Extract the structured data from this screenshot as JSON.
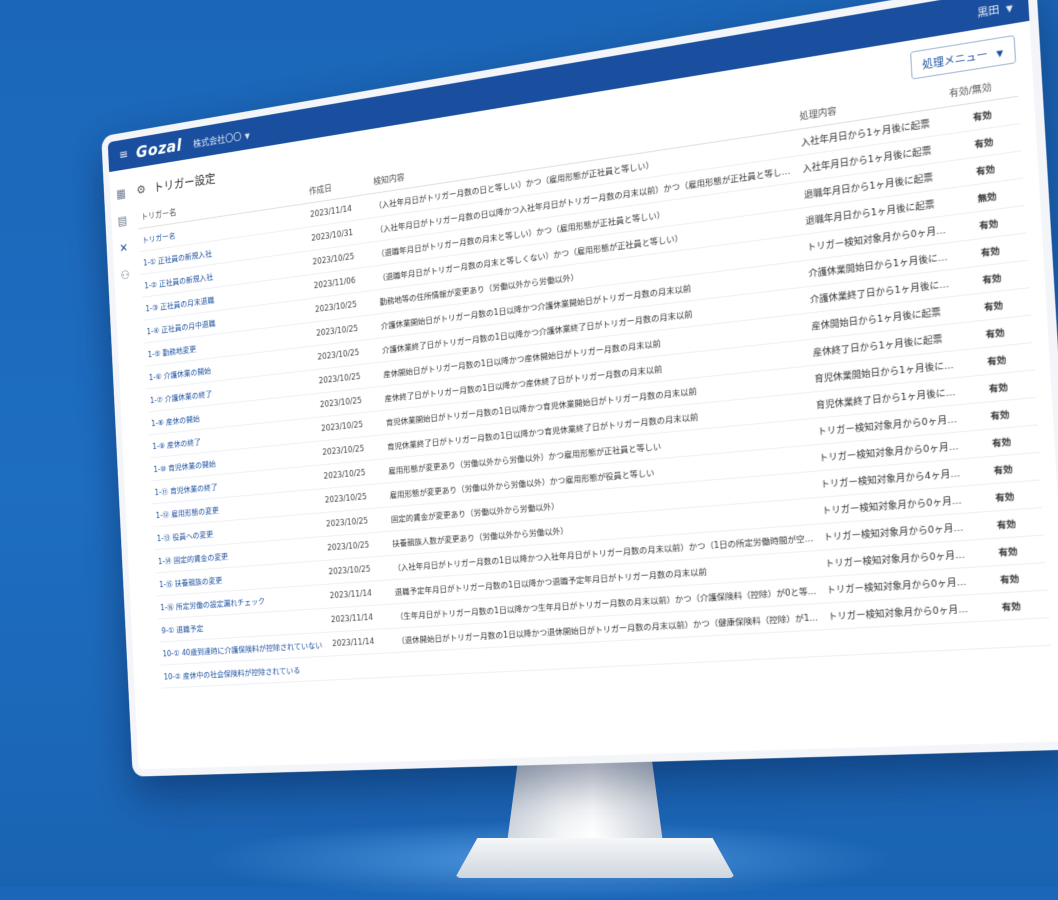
{
  "app": {
    "logo": "Gozal",
    "company": "株式会社〇〇",
    "user": "黒田"
  },
  "page": {
    "title": "トリガー設定",
    "op_menu": "処理メニュー"
  },
  "columns": {
    "name": "トリガー名",
    "date": "作成日",
    "condition": "検知内容",
    "process": "処理内容",
    "status": "有効/無効"
  },
  "rows": [
    {
      "name": "トリガー名",
      "date": "2023/11/14",
      "condition": "（入社年月日がトリガー月数の日と等しい）かつ（雇用形態が正社員と等しい）",
      "process": "入社年月日から1ヶ月後に起票",
      "status": "有効"
    },
    {
      "name": "1-① 正社員の新規入社",
      "date": "2023/10/31",
      "condition": "（入社年月日がトリガー月数の日以降かつ入社年月日がトリガー月数の月末以前）かつ（雇用形態が正社員と等しい）",
      "process": "入社年月日から1ヶ月後に起票",
      "status": "有効"
    },
    {
      "name": "1-② 正社員の新規入社",
      "date": "2023/10/25",
      "condition": "（退職年月日がトリガー月数の月末と等しい）かつ（雇用形態が正社員と等しい）",
      "process": "退職年月日から1ヶ月後に起票",
      "status": "有効"
    },
    {
      "name": "1-③ 正社員の月末退職",
      "date": "2023/11/06",
      "condition": "（退職年月日がトリガー月数の月末と等しくない）かつ（雇用形態が正社員と等しい）",
      "process": "退職年月日から1ヶ月後に起票",
      "status": "無効"
    },
    {
      "name": "1-④ 正社員の月中退職",
      "date": "2023/10/25",
      "condition": "勤務地等の住所情報が変更あり（労働以外から労働以外）",
      "process": "トリガー検知対象月から0ヶ月後に起票",
      "status": "有効"
    },
    {
      "name": "1-⑤ 勤務地変更",
      "date": "2023/10/25",
      "condition": "介護休業開始日がトリガー月数の1日以降かつ介護休業開始日がトリガー月数の月末以前",
      "process": "介護休業開始日から1ヶ月後に起票",
      "status": "有効"
    },
    {
      "name": "1-⑥ 介護休業の開始",
      "date": "2023/10/25",
      "condition": "介護休業終了日がトリガー月数の1日以降かつ介護休業終了日がトリガー月数の月末以前",
      "process": "介護休業終了日から1ヶ月後に起票",
      "status": "有効"
    },
    {
      "name": "1-⑦ 介護休業の終了",
      "date": "2023/10/25",
      "condition": "産休開始日がトリガー月数の1日以降かつ産休開始日がトリガー月数の月末以前",
      "process": "産休開始日から1ヶ月後に起票",
      "status": "有効"
    },
    {
      "name": "1-⑧ 産休の開始",
      "date": "2023/10/25",
      "condition": "産休終了日がトリガー月数の1日以降かつ産休終了日がトリガー月数の月末以前",
      "process": "産休終了日から1ヶ月後に起票",
      "status": "有効"
    },
    {
      "name": "1-⑨ 産休の終了",
      "date": "2023/10/25",
      "condition": "育児休業開始日がトリガー月数の1日以降かつ育児休業開始日がトリガー月数の月末以前",
      "process": "育児休業開始日から1ヶ月後に起票",
      "status": "有効"
    },
    {
      "name": "1-⑩ 育児休業の開始",
      "date": "2023/10/25",
      "condition": "育児休業終了日がトリガー月数の1日以降かつ育児休業終了日がトリガー月数の月末以前",
      "process": "育児休業終了日から1ヶ月後に起票",
      "status": "有効"
    },
    {
      "name": "1-⑪ 育児休業の終了",
      "date": "2023/10/25",
      "condition": "雇用形態が変更あり（労働以外から労働以外）かつ雇用形態が正社員と等しい",
      "process": "トリガー検知対象月から0ヶ月後に起票",
      "status": "有効"
    },
    {
      "name": "1-⑫ 雇用形態の変更",
      "date": "2023/10/25",
      "condition": "雇用形態が変更あり（労働以外から労働以外）かつ雇用形態が役員と等しい",
      "process": "トリガー検知対象月から0ヶ月後に起票",
      "status": "有効"
    },
    {
      "name": "1-⑬ 役員への変更",
      "date": "2023/10/25",
      "condition": "固定的賃金が変更あり（労働以外から労働以外）",
      "process": "トリガー検知対象月から4ヶ月後に起票",
      "status": "有効"
    },
    {
      "name": "1-⑭ 固定的賃金の変更",
      "date": "2023/10/25",
      "condition": "扶養親族人数が変更あり（労働以外から労働以外）",
      "process": "トリガー検知対象月から0ヶ月後に起票",
      "status": "有効"
    },
    {
      "name": "1-⑮ 扶養親族の変更",
      "date": "2023/10/25",
      "condition": "（入社年月日がトリガー月数の1日以降かつ入社年月日がトリガー月数の月末以前）かつ（1日の所定労働時間が空欄であるまたは1週の所定労働日数が空欄である）",
      "process": "トリガー検知対象月から0ヶ月後に起票",
      "status": "有効"
    },
    {
      "name": "1-⑯ 所定労働の設定漏れチェック",
      "date": "2023/11/14",
      "condition": "退職予定年月日がトリガー月数の1日以降かつ退職予定年月日がトリガー月数の月末以前",
      "process": "トリガー検知対象月から0ヶ月後に起票",
      "status": "有効"
    },
    {
      "name": "9-① 退職予定",
      "date": "2023/11/14",
      "condition": "（生年月日がトリガー月数の1日以降かつ生年月日がトリガー月数の月末以前）かつ（介護保険料（控除）が0と等しい）",
      "process": "トリガー検知対象月から0ヶ月後に起票",
      "status": "有効"
    },
    {
      "name": "10-① 40歳到達時に介護保険料が控除されていない",
      "date": "2023/11/14",
      "condition": "（退休開始日がトリガー月数の1日以降かつ退休開始日がトリガー月数の月末以前）かつ（健康保険料（控除）が1以上または厚生年金保険料が1以上）",
      "process": "トリガー検知対象月から0ヶ月後に起票",
      "status": "有効"
    },
    {
      "name": "10-② 産休中の社会保険料が控除されている",
      "date": "",
      "condition": "",
      "process": "",
      "status": ""
    }
  ]
}
